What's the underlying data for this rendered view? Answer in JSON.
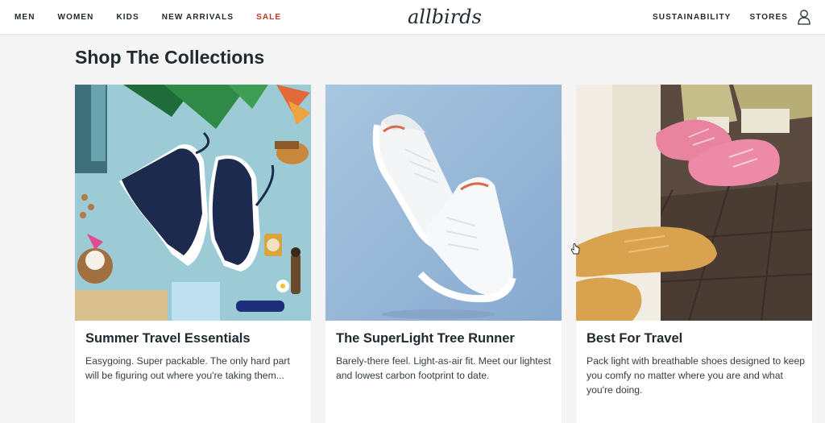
{
  "nav": {
    "left": [
      "MEN",
      "WOMEN",
      "KIDS",
      "NEW ARRIVALS",
      "SALE"
    ],
    "right": [
      "SUSTAINABILITY",
      "STORES"
    ],
    "logo": "allbirds",
    "sale_color": "#c2391c"
  },
  "section": {
    "heading": "Shop The Collections"
  },
  "cards": [
    {
      "title": "Summer Travel Essentials",
      "description": "Easygoing. Super packable. The only hard part will be figuring out where you're taking them...",
      "image": "navy-sneakers-flatlay"
    },
    {
      "title": "The SuperLight Tree Runner",
      "description": "Barely-there feel. Light-as-air fit. Meet our lightest and lowest carbon footprint to date.",
      "image": "white-floating-sneakers"
    },
    {
      "title": "Best For Travel",
      "description": "Pack light with breathable shoes designed to keep you comfy no matter where you are and what you're doing.",
      "image": "pink-and-tan-sneakers"
    }
  ]
}
